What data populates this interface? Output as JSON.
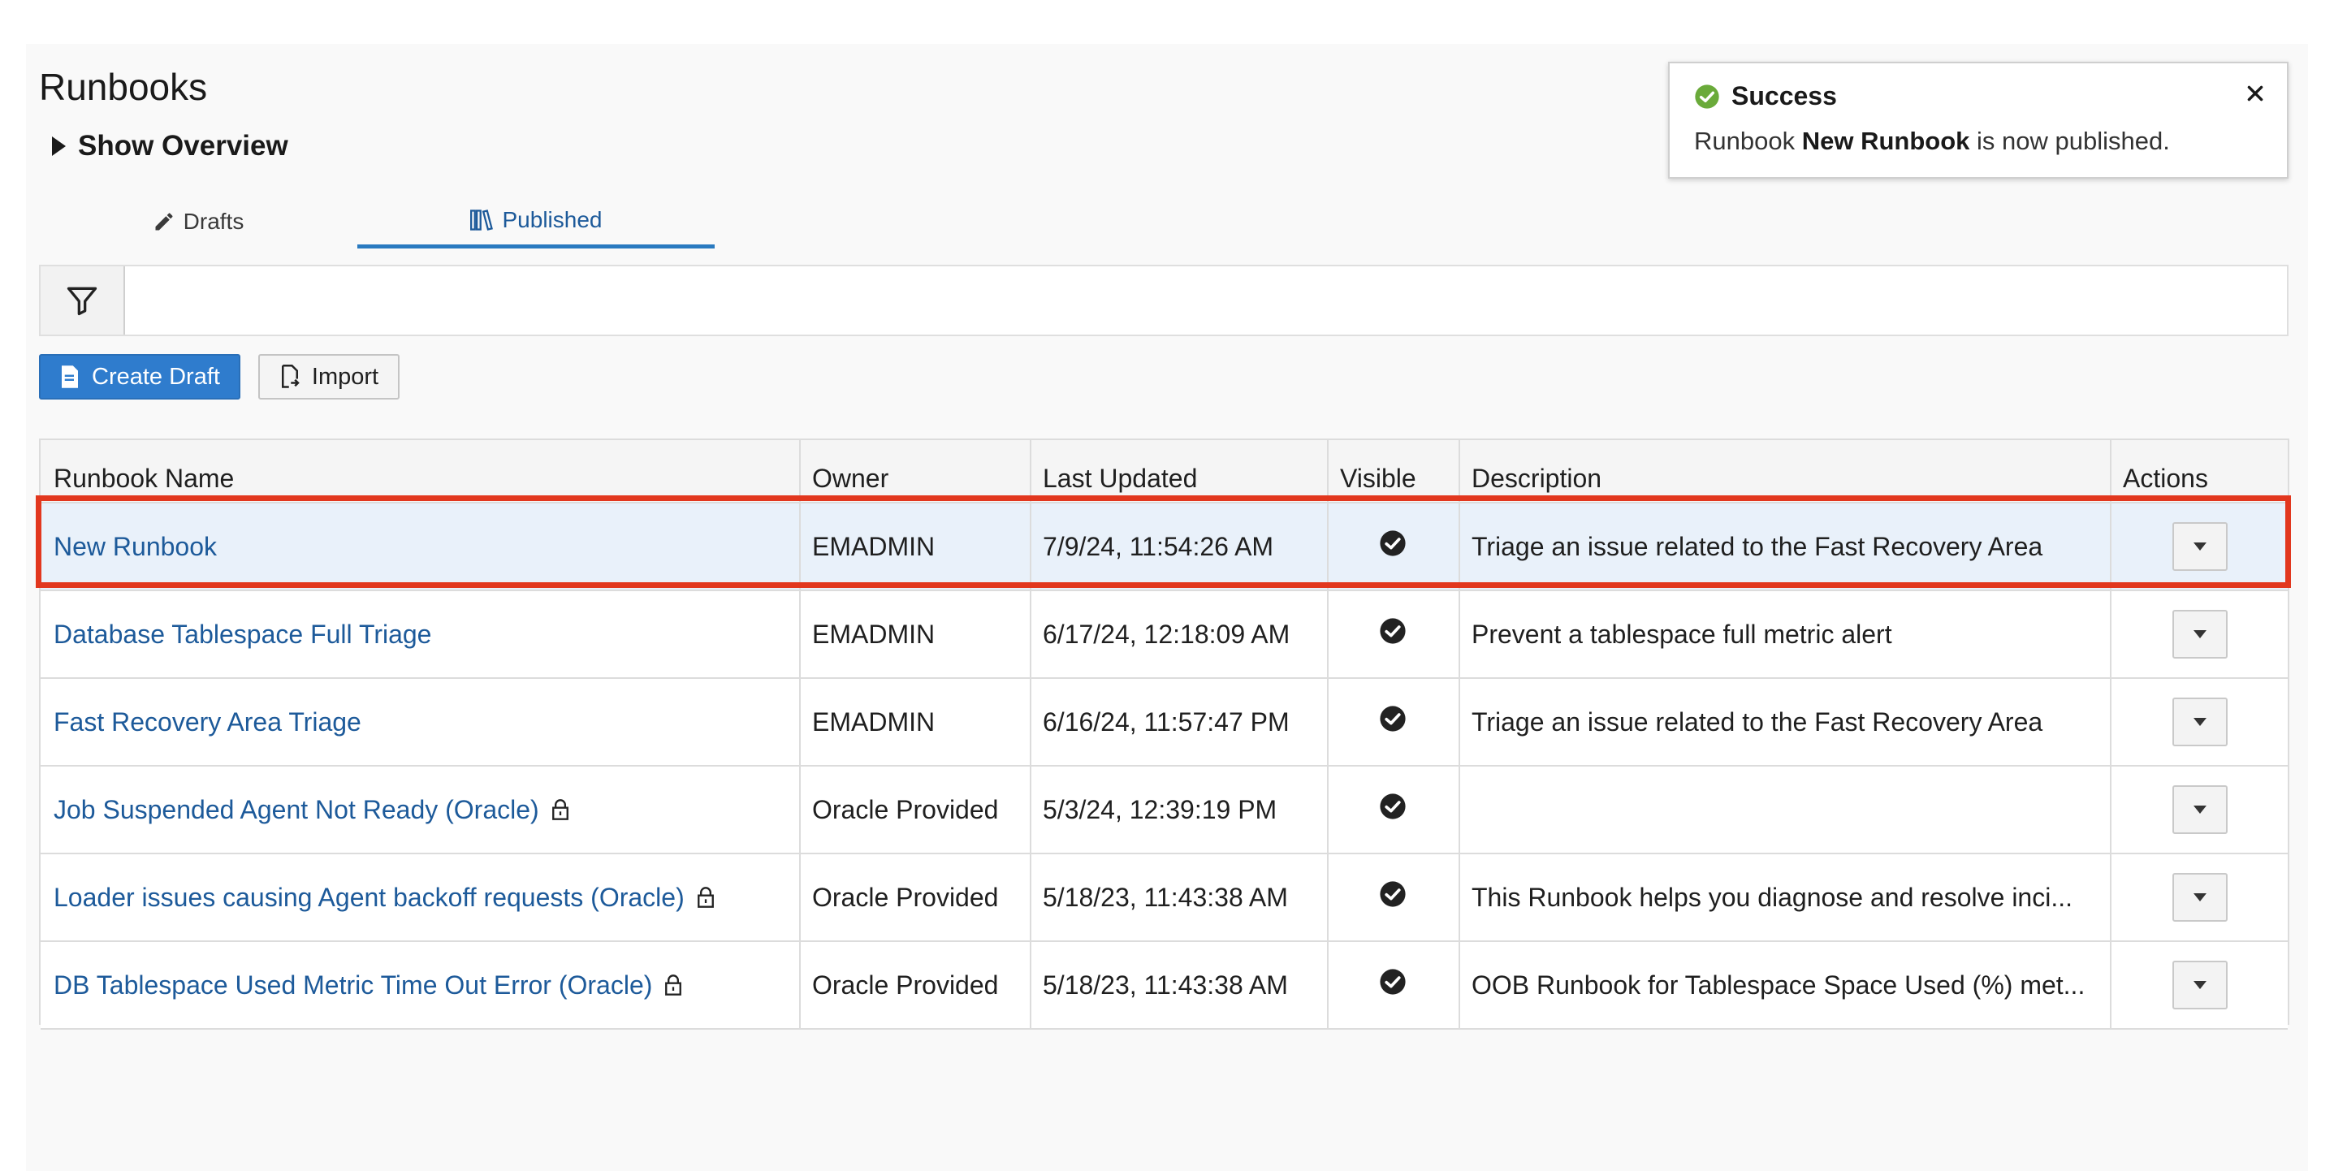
{
  "page": {
    "title": "Runbooks",
    "overview_label": "Show Overview"
  },
  "tabs": [
    {
      "label": "Drafts",
      "icon": "pencil-icon",
      "active": false
    },
    {
      "label": "Published",
      "icon": "books-icon",
      "active": true
    }
  ],
  "toolbar": {
    "create_label": "Create Draft",
    "import_label": "Import",
    "filter_icon": "filter-icon"
  },
  "table": {
    "columns": [
      "Runbook Name",
      "Owner",
      "Last Updated",
      "Visible",
      "Description",
      "Actions"
    ],
    "rows": [
      {
        "name": "New Runbook",
        "owner": "EMADMIN",
        "updated": "7/9/24, 11:54:26 AM",
        "visible": true,
        "description": "Triage an issue related to the Fast Recovery Area",
        "locked": false,
        "selected": true
      },
      {
        "name": "Database Tablespace Full Triage",
        "owner": "EMADMIN",
        "updated": "6/17/24, 12:18:09 AM",
        "visible": true,
        "description": "Prevent a tablespace full metric alert",
        "locked": false,
        "selected": false
      },
      {
        "name": "Fast Recovery Area Triage",
        "owner": "EMADMIN",
        "updated": "6/16/24, 11:57:47 PM",
        "visible": true,
        "description": "Triage an issue related to the Fast Recovery Area",
        "locked": false,
        "selected": false
      },
      {
        "name": "Job Suspended Agent Not Ready (Oracle)",
        "owner": "Oracle Provided",
        "updated": "5/3/24, 12:39:19 PM",
        "visible": true,
        "description": "",
        "locked": true,
        "selected": false
      },
      {
        "name": "Loader issues causing Agent backoff requests (Oracle)",
        "owner": "Oracle Provided",
        "updated": "5/18/23, 11:43:38 AM",
        "visible": true,
        "description": "This Runbook helps you diagnose and resolve inci...",
        "locked": true,
        "selected": false
      },
      {
        "name": "DB Tablespace Used Metric Time Out Error (Oracle)",
        "owner": "Oracle Provided",
        "updated": "5/18/23, 11:43:38 AM",
        "visible": true,
        "description": "OOB Runbook for Tablespace Space Used (%) met...",
        "locked": true,
        "selected": false
      }
    ]
  },
  "toast": {
    "title": "Success",
    "msg_prefix": "Runbook ",
    "msg_bold": "New Runbook",
    "msg_suffix": " is now published.",
    "status_color": "#6aaa3a"
  },
  "colors": {
    "accent": "#2f7ccd",
    "link": "#1d5a9a",
    "highlight": "#e2371e",
    "selected_row": "#e9f1fa"
  }
}
